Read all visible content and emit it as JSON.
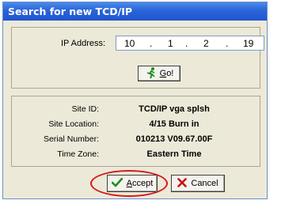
{
  "window": {
    "title": "Search for new TCD/IP"
  },
  "ip": {
    "label": "IP Address:",
    "octets": [
      "10",
      "1",
      "2",
      "19"
    ],
    "separator": "."
  },
  "go_button": {
    "prefix": "G",
    "rest": "o!"
  },
  "info": {
    "rows": [
      {
        "label": "Site ID:",
        "value": "TCD/IP vga splsh"
      },
      {
        "label": "Site Location:",
        "value": "4/15 Burn in"
      },
      {
        "label": "Serial Number:",
        "value": "010213 V09.67.00F"
      },
      {
        "label": "Time Zone:",
        "value": "Eastern Time"
      }
    ]
  },
  "buttons": {
    "accept": {
      "prefix": "A",
      "rest": "ccept"
    },
    "cancel": {
      "label": "Cancel"
    }
  },
  "colors": {
    "highlight": "#d61a1a",
    "title_bar": "#2a64d8"
  }
}
